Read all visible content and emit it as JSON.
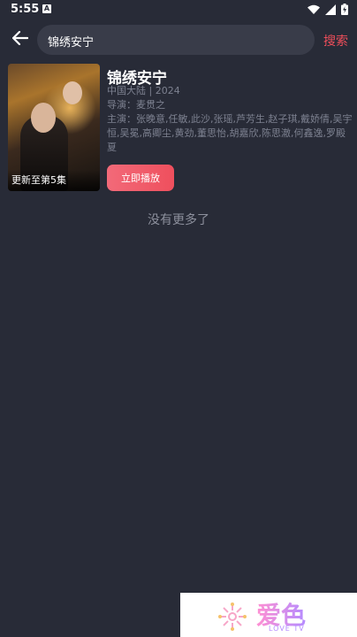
{
  "status": {
    "time": "5:55",
    "notif_icon": "A"
  },
  "search": {
    "value": "锦绣安宁",
    "placeholder": "",
    "button_label": "搜索"
  },
  "result": {
    "title": "锦绣安宁",
    "region_year": "中国大陆 | 2024",
    "director": "导演：麦贯之",
    "cast": "主演：张晚意,任敏,此沙,张瑶,芦芳生,赵子琪,戴娇倩,吴宇恒,吴冕,高卿尘,黄劲,董思怡,胡嘉欣,陈思澈,何鑫逸,罗殿夏",
    "poster_badge": "更新至第5集",
    "play_label": "立即播放"
  },
  "footer": {
    "no_more": "没有更多了"
  },
  "watermark": {
    "brand": "爱色",
    "sub": "LOVE TV"
  },
  "colors": {
    "background": "#282b37",
    "accent": "#ee4e5a",
    "search_bg": "#393c49",
    "muted": "#7d8190"
  }
}
